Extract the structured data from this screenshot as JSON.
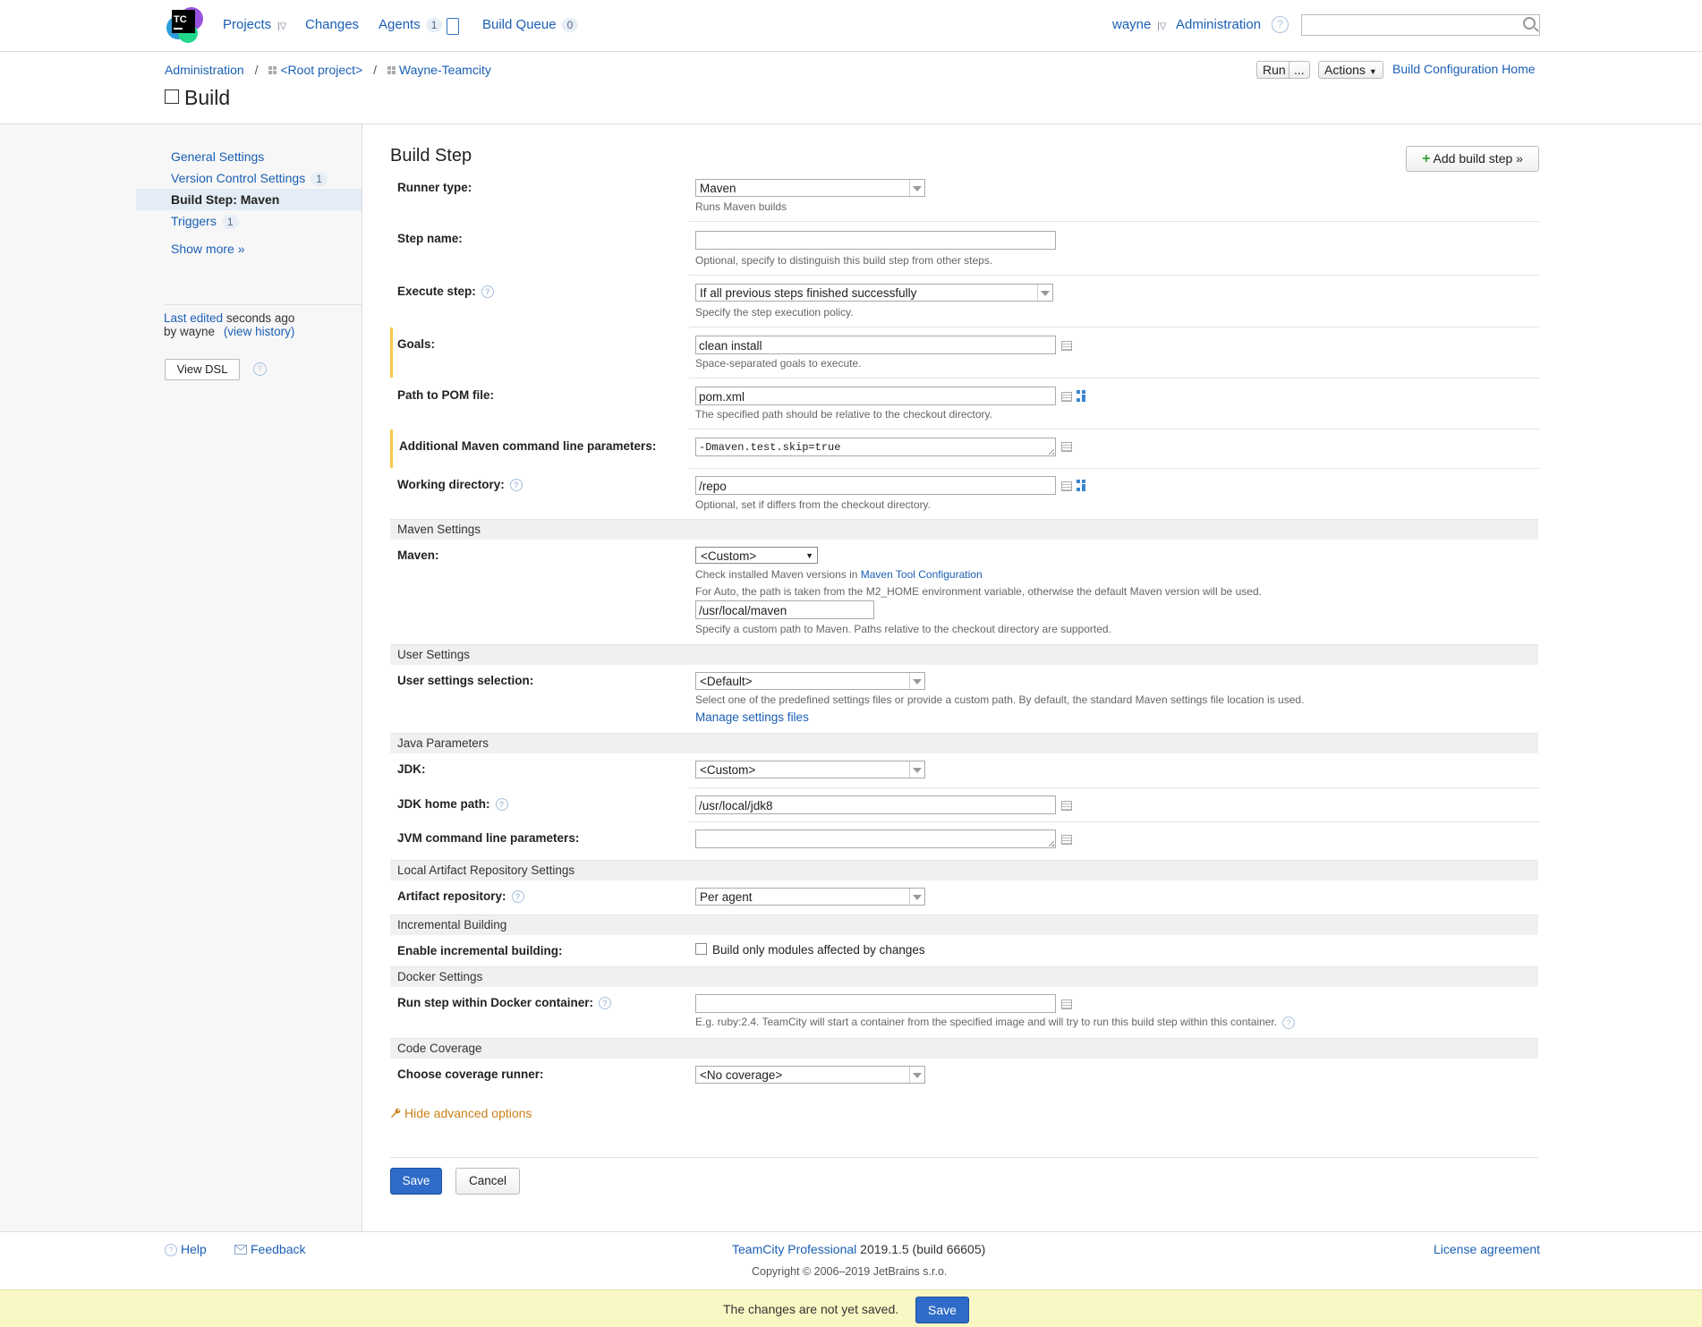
{
  "topbar": {
    "logo_text": "TC",
    "projects": "Projects",
    "changes": "Changes",
    "agents": "Agents",
    "agents_count": "1",
    "build_queue": "Build Queue",
    "build_queue_count": "0",
    "user": "wayne",
    "administration": "Administration",
    "help_icon": "?",
    "search_placeholder": ""
  },
  "header": {
    "breadcrumb": [
      "Administration",
      "<Root project>",
      "Wayne-Teamcity"
    ],
    "breadcrumb_sep": "/",
    "title": "Build",
    "run": "Run",
    "run_more": "...",
    "actions": "Actions",
    "config_home": "Build Configuration Home"
  },
  "sidebar": {
    "items": [
      {
        "label": "General Settings",
        "badge": ""
      },
      {
        "label": "Version Control Settings",
        "badge": "1"
      },
      {
        "label": "Build Step: Maven",
        "badge": ""
      },
      {
        "label": "Triggers",
        "badge": "1"
      }
    ],
    "show_more": "Show more »",
    "last_edited": "Last edited",
    "seconds_ago": "seconds ago",
    "by": "by wayne",
    "view_history": "(view history)",
    "view_dsl": "View DSL"
  },
  "form": {
    "title": "Build Step",
    "add_step": "Add build step »",
    "runner_type": {
      "label": "Runner type:",
      "value": "Maven",
      "hint": "Runs Maven builds"
    },
    "step_name": {
      "label": "Step name:",
      "value": "",
      "hint": "Optional, specify to distinguish this build step from other steps."
    },
    "execute_step": {
      "label": "Execute step:",
      "value": "If all previous steps finished successfully",
      "hint": "Specify the step execution policy."
    },
    "goals": {
      "label": "Goals:",
      "value": "clean install",
      "hint": "Space-separated goals to execute."
    },
    "pom": {
      "label": "Path to POM file:",
      "value": "pom.xml",
      "hint": "The specified path should be relative to the checkout directory."
    },
    "additional": {
      "label": "Additional Maven command line parameters:",
      "value": "-Dmaven.test.skip=true"
    },
    "working_dir": {
      "label": "Working directory:",
      "value": "/repo",
      "hint": "Optional, set if differs from the checkout directory."
    },
    "maven_section": "Maven Settings",
    "maven": {
      "label": "Maven:",
      "value": "<Custom>",
      "hint1_prefix": "Check installed Maven versions in",
      "hint1_link": "Maven Tool Configuration",
      "hint2": "For Auto, the path is taken from the M2_HOME environment variable, otherwise the default Maven version will be used.",
      "path": "/usr/local/maven",
      "hint3": "Specify a custom path to Maven. Paths relative to the checkout directory are supported."
    },
    "user_section": "User Settings",
    "user_settings": {
      "label": "User settings selection:",
      "value": "<Default>",
      "hint": "Select one of the predefined settings files or provide a custom path. By default, the standard Maven settings file location is used.",
      "link": "Manage settings files"
    },
    "java_section": "Java Parameters",
    "jdk": {
      "label": "JDK:",
      "value": "<Custom>"
    },
    "jdk_home": {
      "label": "JDK home path:",
      "value": "/usr/local/jdk8"
    },
    "jvm": {
      "label": "JVM command line parameters:",
      "value": ""
    },
    "artifact_section": "Local Artifact Repository Settings",
    "artifact": {
      "label": "Artifact repository:",
      "value": "Per agent"
    },
    "incremental_section": "Incremental Building",
    "incremental": {
      "label": "Enable incremental building:",
      "checkbox_label": "Build only modules affected by changes",
      "checked": false
    },
    "docker_section": "Docker Settings",
    "docker": {
      "label": "Run step within Docker container:",
      "value": "",
      "hint": "E.g. ruby:2.4. TeamCity will start a container from the specified image and will try to run this build step within this container."
    },
    "coverage_section": "Code Coverage",
    "coverage": {
      "label": "Choose coverage runner:",
      "value": "<No coverage>"
    },
    "hide_advanced": "Hide advanced options",
    "save": "Save",
    "cancel": "Cancel"
  },
  "footer": {
    "help": "Help",
    "feedback": "Feedback",
    "product": "TeamCity Professional",
    "version": "2019.1.5 (build 66605)",
    "copyright": "Copyright © 2006–2019 JetBrains s.r.o.",
    "license": "License agreement"
  },
  "unsaved_bar": {
    "message": "The changes are not yet saved.",
    "save": "Save"
  },
  "colors": {
    "link": "#1a5fb4",
    "primary_button": "#2f6bc8",
    "highlight_bar": "#f6c94a",
    "unsaved_bg": "#f9f8c4",
    "advanced_link": "#c8801a"
  },
  "icons": {
    "logo": "teamcity-logo",
    "help": "help-circle-icon",
    "search": "search-icon",
    "expand": "expand-editor-icon",
    "tree": "vcs-tree-icon",
    "wrench": "wrench-icon",
    "feedback": "envelope-icon"
  }
}
